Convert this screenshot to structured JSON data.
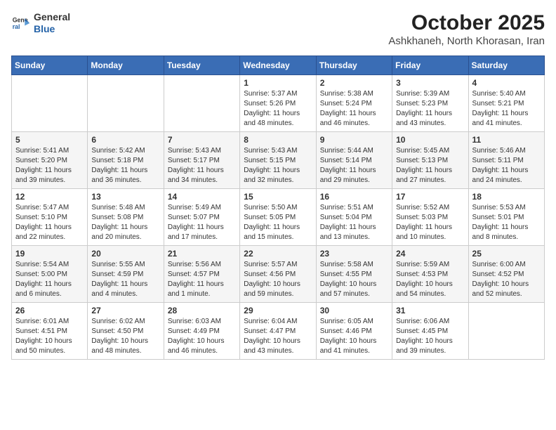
{
  "logo": {
    "general": "General",
    "blue": "Blue"
  },
  "header": {
    "month": "October 2025",
    "location": "Ashkhaneh, North Khorasan, Iran"
  },
  "weekdays": [
    "Sunday",
    "Monday",
    "Tuesday",
    "Wednesday",
    "Thursday",
    "Friday",
    "Saturday"
  ],
  "weeks": [
    [
      {
        "day": "",
        "sunrise": "",
        "sunset": "",
        "daylight": ""
      },
      {
        "day": "",
        "sunrise": "",
        "sunset": "",
        "daylight": ""
      },
      {
        "day": "",
        "sunrise": "",
        "sunset": "",
        "daylight": ""
      },
      {
        "day": "1",
        "sunrise": "Sunrise: 5:37 AM",
        "sunset": "Sunset: 5:26 PM",
        "daylight": "Daylight: 11 hours and 48 minutes."
      },
      {
        "day": "2",
        "sunrise": "Sunrise: 5:38 AM",
        "sunset": "Sunset: 5:24 PM",
        "daylight": "Daylight: 11 hours and 46 minutes."
      },
      {
        "day": "3",
        "sunrise": "Sunrise: 5:39 AM",
        "sunset": "Sunset: 5:23 PM",
        "daylight": "Daylight: 11 hours and 43 minutes."
      },
      {
        "day": "4",
        "sunrise": "Sunrise: 5:40 AM",
        "sunset": "Sunset: 5:21 PM",
        "daylight": "Daylight: 11 hours and 41 minutes."
      }
    ],
    [
      {
        "day": "5",
        "sunrise": "Sunrise: 5:41 AM",
        "sunset": "Sunset: 5:20 PM",
        "daylight": "Daylight: 11 hours and 39 minutes."
      },
      {
        "day": "6",
        "sunrise": "Sunrise: 5:42 AM",
        "sunset": "Sunset: 5:18 PM",
        "daylight": "Daylight: 11 hours and 36 minutes."
      },
      {
        "day": "7",
        "sunrise": "Sunrise: 5:43 AM",
        "sunset": "Sunset: 5:17 PM",
        "daylight": "Daylight: 11 hours and 34 minutes."
      },
      {
        "day": "8",
        "sunrise": "Sunrise: 5:43 AM",
        "sunset": "Sunset: 5:15 PM",
        "daylight": "Daylight: 11 hours and 32 minutes."
      },
      {
        "day": "9",
        "sunrise": "Sunrise: 5:44 AM",
        "sunset": "Sunset: 5:14 PM",
        "daylight": "Daylight: 11 hours and 29 minutes."
      },
      {
        "day": "10",
        "sunrise": "Sunrise: 5:45 AM",
        "sunset": "Sunset: 5:13 PM",
        "daylight": "Daylight: 11 hours and 27 minutes."
      },
      {
        "day": "11",
        "sunrise": "Sunrise: 5:46 AM",
        "sunset": "Sunset: 5:11 PM",
        "daylight": "Daylight: 11 hours and 24 minutes."
      }
    ],
    [
      {
        "day": "12",
        "sunrise": "Sunrise: 5:47 AM",
        "sunset": "Sunset: 5:10 PM",
        "daylight": "Daylight: 11 hours and 22 minutes."
      },
      {
        "day": "13",
        "sunrise": "Sunrise: 5:48 AM",
        "sunset": "Sunset: 5:08 PM",
        "daylight": "Daylight: 11 hours and 20 minutes."
      },
      {
        "day": "14",
        "sunrise": "Sunrise: 5:49 AM",
        "sunset": "Sunset: 5:07 PM",
        "daylight": "Daylight: 11 hours and 17 minutes."
      },
      {
        "day": "15",
        "sunrise": "Sunrise: 5:50 AM",
        "sunset": "Sunset: 5:05 PM",
        "daylight": "Daylight: 11 hours and 15 minutes."
      },
      {
        "day": "16",
        "sunrise": "Sunrise: 5:51 AM",
        "sunset": "Sunset: 5:04 PM",
        "daylight": "Daylight: 11 hours and 13 minutes."
      },
      {
        "day": "17",
        "sunrise": "Sunrise: 5:52 AM",
        "sunset": "Sunset: 5:03 PM",
        "daylight": "Daylight: 11 hours and 10 minutes."
      },
      {
        "day": "18",
        "sunrise": "Sunrise: 5:53 AM",
        "sunset": "Sunset: 5:01 PM",
        "daylight": "Daylight: 11 hours and 8 minutes."
      }
    ],
    [
      {
        "day": "19",
        "sunrise": "Sunrise: 5:54 AM",
        "sunset": "Sunset: 5:00 PM",
        "daylight": "Daylight: 11 hours and 6 minutes."
      },
      {
        "day": "20",
        "sunrise": "Sunrise: 5:55 AM",
        "sunset": "Sunset: 4:59 PM",
        "daylight": "Daylight: 11 hours and 4 minutes."
      },
      {
        "day": "21",
        "sunrise": "Sunrise: 5:56 AM",
        "sunset": "Sunset: 4:57 PM",
        "daylight": "Daylight: 11 hours and 1 minute."
      },
      {
        "day": "22",
        "sunrise": "Sunrise: 5:57 AM",
        "sunset": "Sunset: 4:56 PM",
        "daylight": "Daylight: 10 hours and 59 minutes."
      },
      {
        "day": "23",
        "sunrise": "Sunrise: 5:58 AM",
        "sunset": "Sunset: 4:55 PM",
        "daylight": "Daylight: 10 hours and 57 minutes."
      },
      {
        "day": "24",
        "sunrise": "Sunrise: 5:59 AM",
        "sunset": "Sunset: 4:53 PM",
        "daylight": "Daylight: 10 hours and 54 minutes."
      },
      {
        "day": "25",
        "sunrise": "Sunrise: 6:00 AM",
        "sunset": "Sunset: 4:52 PM",
        "daylight": "Daylight: 10 hours and 52 minutes."
      }
    ],
    [
      {
        "day": "26",
        "sunrise": "Sunrise: 6:01 AM",
        "sunset": "Sunset: 4:51 PM",
        "daylight": "Daylight: 10 hours and 50 minutes."
      },
      {
        "day": "27",
        "sunrise": "Sunrise: 6:02 AM",
        "sunset": "Sunset: 4:50 PM",
        "daylight": "Daylight: 10 hours and 48 minutes."
      },
      {
        "day": "28",
        "sunrise": "Sunrise: 6:03 AM",
        "sunset": "Sunset: 4:49 PM",
        "daylight": "Daylight: 10 hours and 46 minutes."
      },
      {
        "day": "29",
        "sunrise": "Sunrise: 6:04 AM",
        "sunset": "Sunset: 4:47 PM",
        "daylight": "Daylight: 10 hours and 43 minutes."
      },
      {
        "day": "30",
        "sunrise": "Sunrise: 6:05 AM",
        "sunset": "Sunset: 4:46 PM",
        "daylight": "Daylight: 10 hours and 41 minutes."
      },
      {
        "day": "31",
        "sunrise": "Sunrise: 6:06 AM",
        "sunset": "Sunset: 4:45 PM",
        "daylight": "Daylight: 10 hours and 39 minutes."
      },
      {
        "day": "",
        "sunrise": "",
        "sunset": "",
        "daylight": ""
      }
    ]
  ]
}
